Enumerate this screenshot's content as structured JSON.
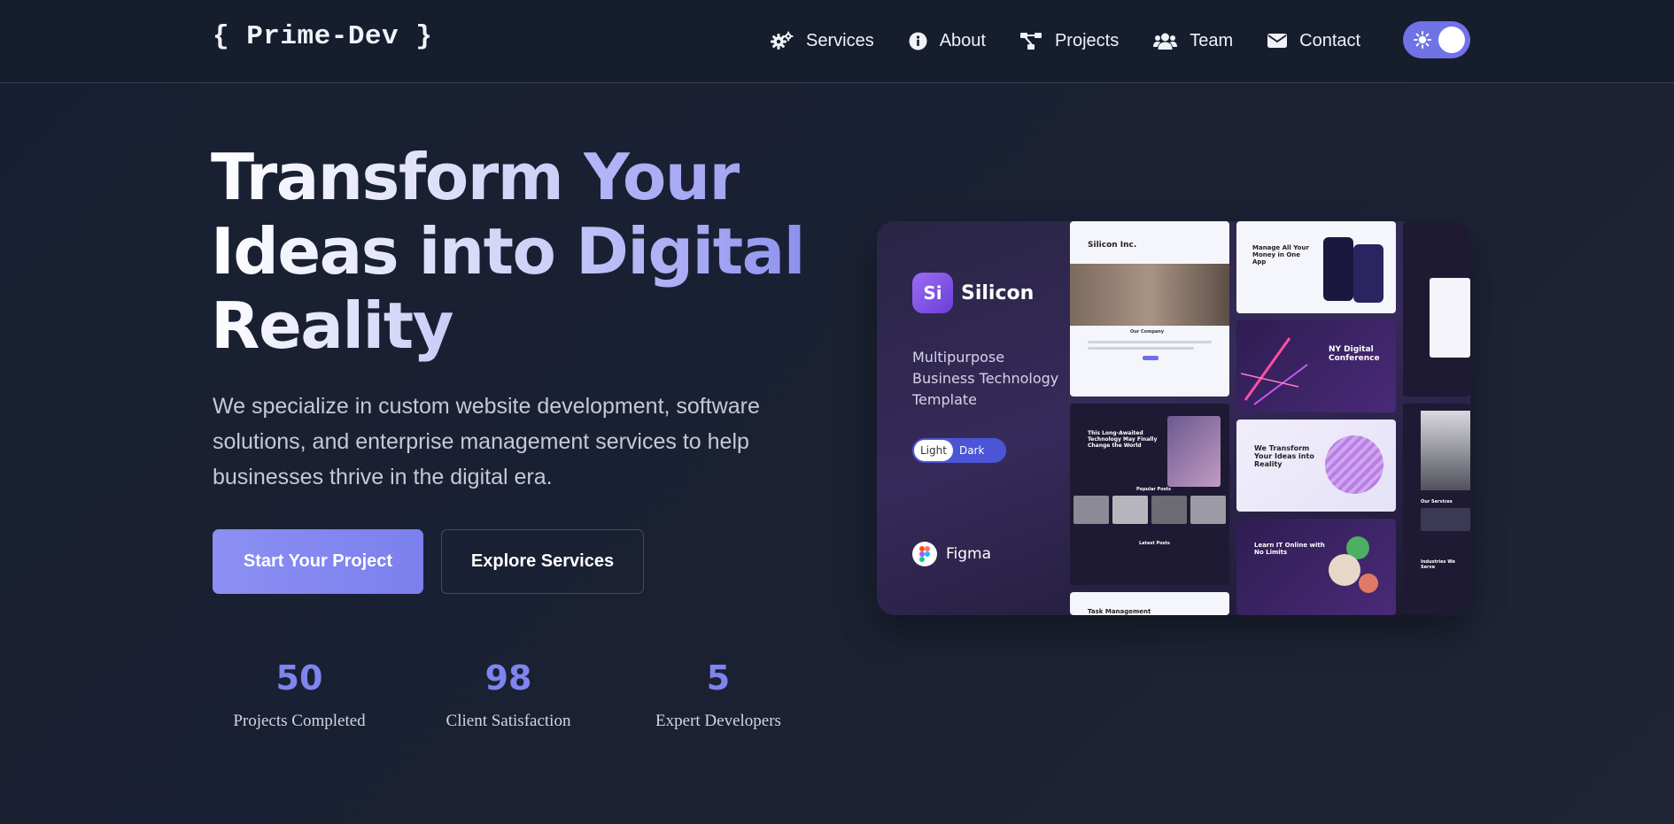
{
  "brand": {
    "logo": "{ Prime-Dev }"
  },
  "nav": {
    "items": [
      {
        "label": "Services",
        "icon": "gears-icon"
      },
      {
        "label": "About",
        "icon": "info-circle-icon"
      },
      {
        "label": "Projects",
        "icon": "project-diagram-icon"
      },
      {
        "label": "Team",
        "icon": "users-icon"
      },
      {
        "label": "Contact",
        "icon": "envelope-icon"
      }
    ],
    "theme_toggle": {
      "state": "on",
      "icon": "sun-icon"
    }
  },
  "hero": {
    "headline": {
      "part1": "Transform ",
      "part2": "Your",
      "part3": "Ideas into ",
      "part4": "Digital",
      "part5": "Reality"
    },
    "lead": "We specialize in custom website development, software solutions, and enterprise management services to help businesses thrive in the digital era.",
    "primary_cta": "Start Your Project",
    "secondary_cta": "Explore Services"
  },
  "stats": [
    {
      "value": "50",
      "label": "Projects Completed"
    },
    {
      "value": "98",
      "label": "Client Satisfaction"
    },
    {
      "value": "5",
      "label": "Expert Developers"
    }
  ],
  "showcase": {
    "brand_badge": "Si",
    "brand_name": "Silicon",
    "description": "Multipurpose Business Technology Template",
    "switch": {
      "light": "Light",
      "dark": "Dark"
    },
    "tool": "Figma",
    "tiles": {
      "t1_title": "Silicon Inc.",
      "t1_sub": "Our Company",
      "t2_title": "Manage All Your Money in One App",
      "t3_title": "NY Digital Conference",
      "t4_title": "This Long-Awaited Technology May Finally Change the World",
      "t4_sub": "Popular Posts",
      "t4_sub2": "Latest Posts",
      "t5_title": "We Transform Your Ideas into Reality",
      "t6_title": "Learn IT Online with No Limits",
      "t7_title": "Task Management",
      "t8_title": "Our Services",
      "t8_sub": "Industries We Serve"
    }
  },
  "colors": {
    "accent": "#7f85ee",
    "bg": "#1b2133",
    "nav_bg": "#161d2d"
  }
}
